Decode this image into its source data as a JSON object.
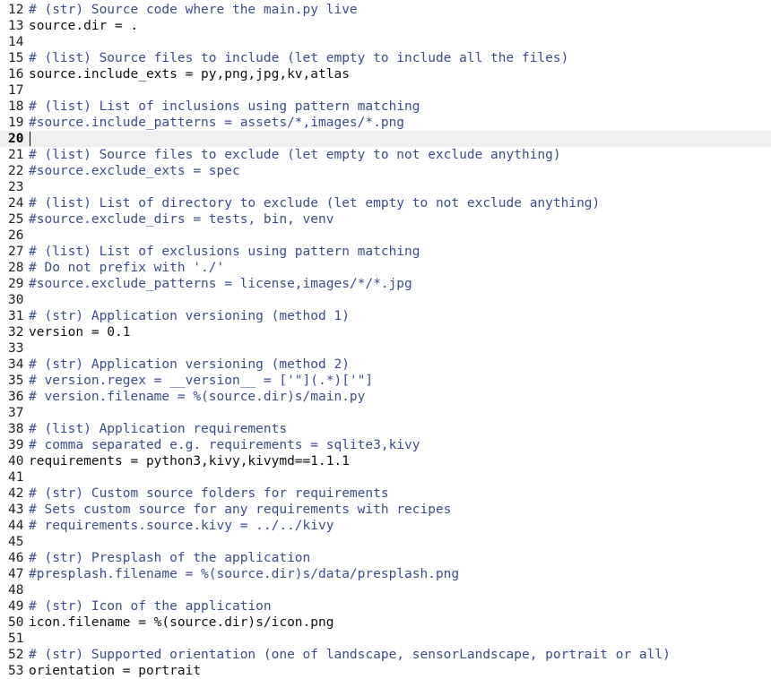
{
  "editor": {
    "current_line": 20,
    "colors": {
      "comment": "#3a4d8f",
      "code": "#111111",
      "current_line_highlight": "#efefef"
    },
    "lines": [
      {
        "n": "12",
        "kind": "comment",
        "text": "# (str) Source code where the main.py live"
      },
      {
        "n": "13",
        "kind": "plain",
        "text": "source.dir = ."
      },
      {
        "n": "14",
        "kind": "plain",
        "text": ""
      },
      {
        "n": "15",
        "kind": "comment",
        "text": "# (list) Source files to include (let empty to include all the files)"
      },
      {
        "n": "16",
        "kind": "plain",
        "text": "source.include_exts = py,png,jpg,kv,atlas"
      },
      {
        "n": "17",
        "kind": "plain",
        "text": ""
      },
      {
        "n": "18",
        "kind": "comment",
        "text": "# (list) List of inclusions using pattern matching"
      },
      {
        "n": "19",
        "kind": "comment",
        "text": "#source.include_patterns = assets/*,images/*.png"
      },
      {
        "n": "20",
        "kind": "plain",
        "text": "",
        "current": true
      },
      {
        "n": "21",
        "kind": "comment",
        "text": "# (list) Source files to exclude (let empty to not exclude anything)"
      },
      {
        "n": "22",
        "kind": "comment",
        "text": "#source.exclude_exts = spec"
      },
      {
        "n": "23",
        "kind": "plain",
        "text": ""
      },
      {
        "n": "24",
        "kind": "comment",
        "text": "# (list) List of directory to exclude (let empty to not exclude anything)"
      },
      {
        "n": "25",
        "kind": "comment",
        "text": "#source.exclude_dirs = tests, bin, venv"
      },
      {
        "n": "26",
        "kind": "plain",
        "text": ""
      },
      {
        "n": "27",
        "kind": "comment",
        "text": "# (list) List of exclusions using pattern matching"
      },
      {
        "n": "28",
        "kind": "comment",
        "text": "# Do not prefix with './'"
      },
      {
        "n": "29",
        "kind": "comment",
        "text": "#source.exclude_patterns = license,images/*/*.jpg"
      },
      {
        "n": "30",
        "kind": "plain",
        "text": ""
      },
      {
        "n": "31",
        "kind": "comment",
        "text": "# (str) Application versioning (method 1)"
      },
      {
        "n": "32",
        "kind": "plain",
        "text": "version = 0.1"
      },
      {
        "n": "33",
        "kind": "plain",
        "text": ""
      },
      {
        "n": "34",
        "kind": "comment",
        "text": "# (str) Application versioning (method 2)"
      },
      {
        "n": "35",
        "kind": "comment",
        "text": "# version.regex = __version__ = ['\"](.*)['\"]"
      },
      {
        "n": "36",
        "kind": "comment",
        "text": "# version.filename = %(source.dir)s/main.py"
      },
      {
        "n": "37",
        "kind": "plain",
        "text": ""
      },
      {
        "n": "38",
        "kind": "comment",
        "text": "# (list) Application requirements"
      },
      {
        "n": "39",
        "kind": "comment",
        "text": "# comma separated e.g. requirements = sqlite3,kivy"
      },
      {
        "n": "40",
        "kind": "plain",
        "text": "requirements = python3,kivy,kivymd==1.1.1"
      },
      {
        "n": "41",
        "kind": "plain",
        "text": ""
      },
      {
        "n": "42",
        "kind": "comment",
        "text": "# (str) Custom source folders for requirements"
      },
      {
        "n": "43",
        "kind": "comment",
        "text": "# Sets custom source for any requirements with recipes"
      },
      {
        "n": "44",
        "kind": "comment",
        "text": "# requirements.source.kivy = ../../kivy"
      },
      {
        "n": "45",
        "kind": "plain",
        "text": ""
      },
      {
        "n": "46",
        "kind": "comment",
        "text": "# (str) Presplash of the application"
      },
      {
        "n": "47",
        "kind": "comment",
        "text": "#presplash.filename = %(source.dir)s/data/presplash.png"
      },
      {
        "n": "48",
        "kind": "plain",
        "text": ""
      },
      {
        "n": "49",
        "kind": "comment",
        "text": "# (str) Icon of the application"
      },
      {
        "n": "50",
        "kind": "plain",
        "text": "icon.filename = %(source.dir)s/icon.png"
      },
      {
        "n": "51",
        "kind": "plain",
        "text": ""
      },
      {
        "n": "52",
        "kind": "comment",
        "text": "# (str) Supported orientation (one of landscape, sensorLandscape, portrait or all)"
      },
      {
        "n": "53",
        "kind": "plain",
        "text": "orientation = portrait"
      }
    ]
  }
}
